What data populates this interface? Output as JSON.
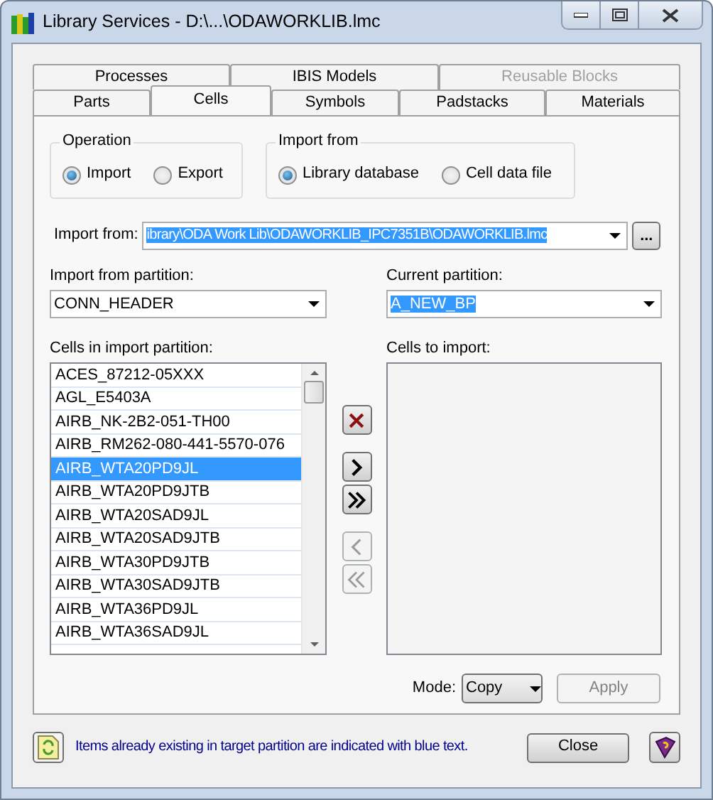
{
  "window": {
    "title": "Library Services - D:\\...\\ODAWORKLIB.lmc"
  },
  "tab_rows": [
    {
      "tabs": [
        {
          "label": "Processes",
          "selected": false,
          "disabled": false
        },
        {
          "label": "IBIS Models",
          "selected": false,
          "disabled": false
        },
        {
          "label": "Reusable Blocks",
          "selected": false,
          "disabled": true
        }
      ]
    },
    {
      "tabs": [
        {
          "label": "Parts",
          "selected": false,
          "disabled": false
        },
        {
          "label": "Cells",
          "selected": true,
          "disabled": false
        },
        {
          "label": "Symbols",
          "selected": false,
          "disabled": false
        },
        {
          "label": "Padstacks",
          "selected": false,
          "disabled": false
        },
        {
          "label": "Materials",
          "selected": false,
          "disabled": false
        }
      ]
    }
  ],
  "operation": {
    "title": "Operation",
    "options": [
      {
        "label": "Import",
        "selected": true
      },
      {
        "label": "Export",
        "selected": false
      }
    ]
  },
  "import_source": {
    "title": "Import from",
    "options": [
      {
        "label": "Library database",
        "selected": true
      },
      {
        "label": "Cell data file",
        "selected": false
      }
    ]
  },
  "import_path": {
    "label": "Import from:",
    "value": "ibrary\\ODA Work Lib\\ODAWORKLIB_IPC7351B\\ODAWORKLIB.lmc",
    "highlighted": true,
    "browse": "..."
  },
  "import_partition": {
    "label": "Import from partition:",
    "value": "CONN_HEADER",
    "highlighted": false
  },
  "current_partition": {
    "label": "Current partition:",
    "value": "A_NEW_BP",
    "highlighted": true
  },
  "source_cells": {
    "label": "Cells in import partition:",
    "items": [
      {
        "text": "ACES_87212-05XXX",
        "selected": false
      },
      {
        "text": "AGL_E5403A",
        "selected": false
      },
      {
        "text": "AIRB_NK-2B2-051-TH00",
        "selected": false
      },
      {
        "text": "AIRB_RM262-080-441-5570-076",
        "selected": false
      },
      {
        "text": "AIRB_WTA20PD9JL",
        "selected": true
      },
      {
        "text": "AIRB_WTA20PD9JTB",
        "selected": false
      },
      {
        "text": "AIRB_WTA20SAD9JL",
        "selected": false
      },
      {
        "text": "AIRB_WTA20SAD9JTB",
        "selected": false
      },
      {
        "text": "AIRB_WTA30PD9JTB",
        "selected": false
      },
      {
        "text": "AIRB_WTA30SAD9JTB",
        "selected": false
      },
      {
        "text": "AIRB_WTA36PD9JL",
        "selected": false
      },
      {
        "text": "AIRB_WTA36SAD9JL",
        "selected": false
      }
    ]
  },
  "transfer_buttons": [
    {
      "kind": "remove",
      "disabled": false
    },
    {
      "kind": "add",
      "disabled": false
    },
    {
      "kind": "add_all",
      "disabled": false
    },
    {
      "kind": "back",
      "disabled": true
    },
    {
      "kind": "back_all",
      "disabled": true
    }
  ],
  "target_cells": {
    "label": "Cells to import:"
  },
  "mode": {
    "label": "Mode:",
    "value": "Copy"
  },
  "apply": {
    "label": "Apply",
    "disabled": true
  },
  "footer": {
    "message": "Items already existing in target partition are indicated with blue text.",
    "close": "Close"
  }
}
